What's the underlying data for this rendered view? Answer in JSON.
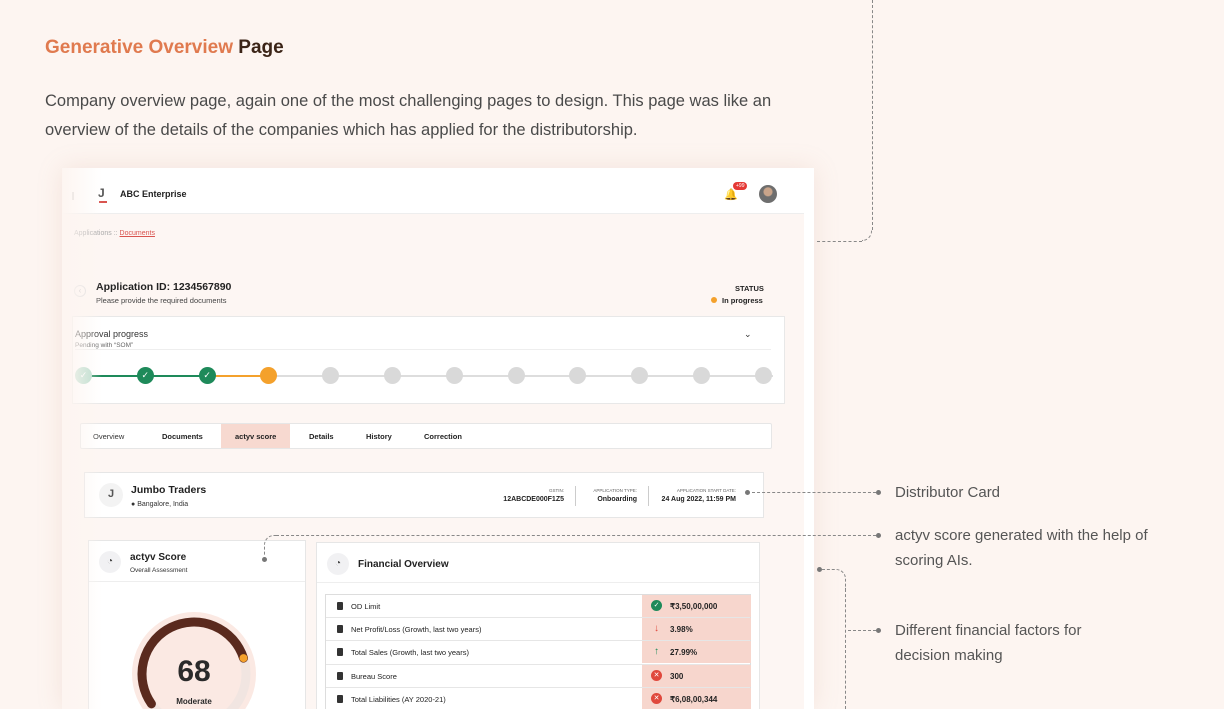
{
  "header": {
    "title_accent": "Generative Overview",
    "title_rest": "Page",
    "description": "Company overview page, again one of the most challenging pages to design. This page was like an overview of the details of the companies which has applied for the distributorship."
  },
  "mockup": {
    "topbar": {
      "logo": "J",
      "company": "ABC Enterprise",
      "notification_badge": "+99",
      "bell_icon": "bell-icon",
      "avatar_icon": "avatar"
    },
    "breadcrumb": {
      "parent": "Applications ::",
      "current": "Documents"
    },
    "application": {
      "id_label": "Application ID: 1234567890",
      "subtitle": "Please provide the required documents",
      "status_label": "STATUS",
      "status_value": "In progress",
      "status_color": "#f4a12c"
    },
    "approval": {
      "title": "Approval progress",
      "pending": "Pending with “SOM”",
      "completed_steps": 3,
      "current_step": 4,
      "total_steps": 12
    },
    "tabs": [
      {
        "label": "Overview"
      },
      {
        "label": "Documents"
      },
      {
        "label": "actyv score",
        "active": true
      },
      {
        "label": "Details"
      },
      {
        "label": "History"
      },
      {
        "label": "Correction"
      }
    ],
    "distributor": {
      "logo": "J",
      "name": "Jumbo Traders",
      "location": "Bangalore, India",
      "gstin_label": "GSTIN:",
      "gstin": "12ABCDE000F1Z5",
      "type_label": "APPLICATION TYPE:",
      "type": "Onboarding",
      "start_label": "APPLICATION START DATE:",
      "start": "24 Aug 2022, 11:59 PM"
    },
    "score": {
      "title": "actyv Score",
      "subtitle": "Overall Assessment",
      "value": "68",
      "level": "Moderate",
      "fill_fraction": 0.68
    },
    "financial": {
      "title": "Financial Overview",
      "rows": [
        {
          "label": "OD Limit",
          "value": "₹3,50,00,000",
          "icon": "check"
        },
        {
          "label": "Net Profit/Loss (Growth, last two years)",
          "value": "3.98%",
          "icon": "down"
        },
        {
          "label": "Total Sales (Growth, last two years)",
          "value": "27.99%",
          "icon": "up"
        },
        {
          "label": "Bureau Score",
          "value": "300",
          "icon": "x"
        },
        {
          "label": "Total Liabilities (AY 2020-21)",
          "value": "₹6,08,00,344",
          "icon": "x"
        }
      ]
    }
  },
  "annotations": {
    "distributor_card": "Distributor Card",
    "actyv_score_line1": "actyv score generated with the help of",
    "actyv_score_line2": "scoring AIs.",
    "financial_line1": "Different financial factors for",
    "financial_line2": "decision making"
  },
  "colors": {
    "accent": "#e07a4f",
    "title_dark": "#3b2417",
    "success": "#1e8a5a",
    "warning": "#f4a12c",
    "danger": "#e0483c",
    "highlight": "#f7d6cd"
  }
}
